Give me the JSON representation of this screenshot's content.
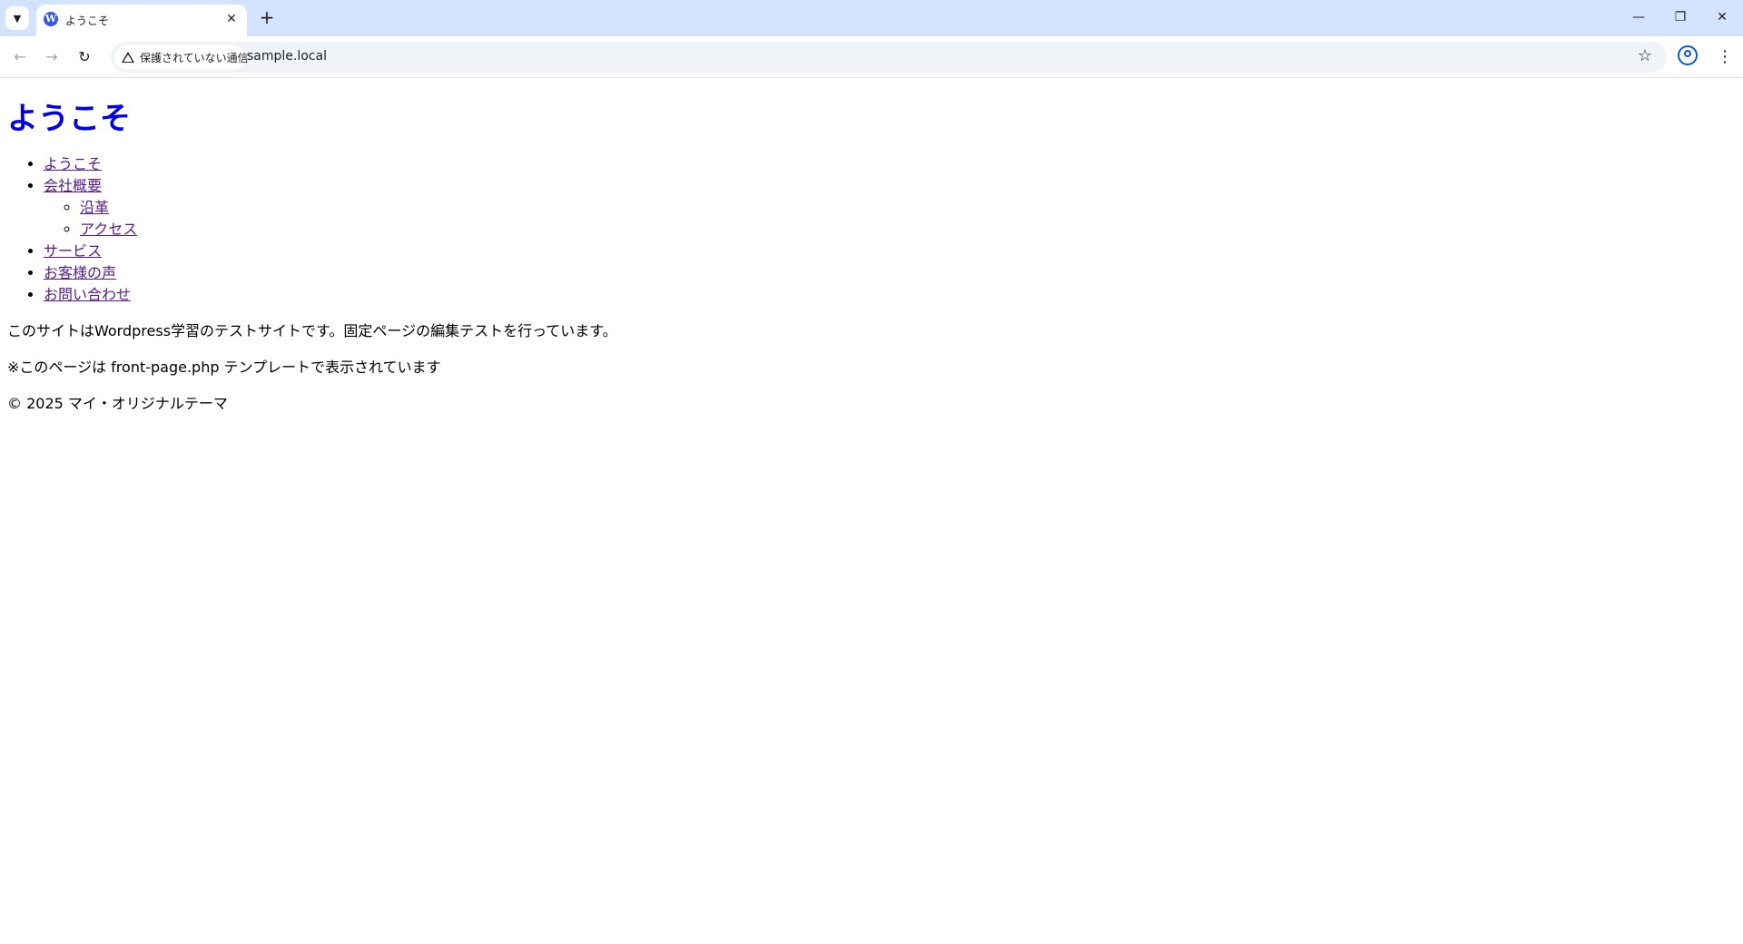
{
  "browser": {
    "tab_title": "ようこそ",
    "security_label": "保護されていない通信",
    "url": "sample.local"
  },
  "page": {
    "site_title": "ようこそ",
    "nav": [
      {
        "label": "ようこそ"
      },
      {
        "label": "会社概要",
        "children": [
          {
            "label": "沿革"
          },
          {
            "label": "アクセス"
          }
        ]
      },
      {
        "label": "サービス"
      },
      {
        "label": "お客様の声"
      },
      {
        "label": "お問い合わせ"
      }
    ],
    "paragraphs": [
      "このサイトはWordpress学習のテストサイトです。固定ページの編集テストを行っています。",
      "※このページは front-page.php テンプレートで表示されています"
    ],
    "footer": "© 2025 マイ・オリジナルテーマ"
  }
}
